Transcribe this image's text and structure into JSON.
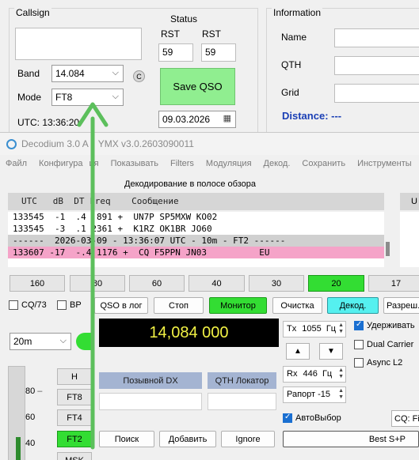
{
  "logger": {
    "callsign_title": "Callsign",
    "callsign_value": "",
    "band_label": "Band",
    "band_value": "14.084",
    "mode_label": "Mode",
    "mode_value": "FT8",
    "c_button": "C",
    "utc_label": "UTC: 13:36:20",
    "status_title": "Status",
    "rst_label_1": "RST",
    "rst_label_2": "RST",
    "rst_sent": "59",
    "rst_rcvd": "59",
    "save_button": "Save QSO",
    "date_value": "09.03.2026",
    "information_title": "Information",
    "name_label": "Name",
    "qth_label": "QTH",
    "grid_label": "Grid",
    "distance": "Distance: ---"
  },
  "window": {
    "title": "Decodium 3.0 AI... v3.0.2603090011",
    "title_visible_1": "Decodium 3.0 A",
    "title_visible_2": "YMX v3.0.2603090011",
    "menu": [
      "Файл",
      "Конфигурация",
      "Показывать",
      "Filters",
      "Модуляция",
      "Декод.",
      "Сохранить",
      "Инструменты"
    ],
    "menu_visible": [
      "Файл",
      "Конфигура",
      "ия",
      "Показывать",
      "Filters",
      "Модуляция",
      "Декод.",
      "Сохранить",
      "Инструменты"
    ]
  },
  "decode": {
    "title": "Декодирование в полосе обзора",
    "header": "UTC   dB  DT Freq    Сообщение",
    "right_header": "U",
    "lines": [
      {
        "text": "133545  -1  .4  891 +  UN7P SP5MXW KO02",
        "style": "normal"
      },
      {
        "text": "133545  -3  .1 2361 +  K1RZ OK1BR JO60",
        "style": "normal"
      },
      {
        "text": "------  2026-03-09 - 13:36:07 UTC - 10m - FT2 ------",
        "style": "sep"
      },
      {
        "text": "133607 -17  -.4 1176 +  CQ F5PPN JN03          EU",
        "style": "cq"
      }
    ]
  },
  "bands": [
    {
      "label": "160",
      "active": false
    },
    {
      "label": "80",
      "active": false
    },
    {
      "label": "60",
      "active": false
    },
    {
      "label": "40",
      "active": false
    },
    {
      "label": "30",
      "active": false
    },
    {
      "label": "20",
      "active": true
    },
    {
      "label": "17",
      "active": false
    }
  ],
  "controls": {
    "cq73": "CQ/73",
    "bp": "BP",
    "qso_log": "QSO в лог",
    "stop": "Стоп",
    "monitor": "Монитор",
    "clear": "Очистка",
    "decode": "Декод.",
    "enable": "Разреш...",
    "band_select": "20m",
    "frequency": "14,084 000",
    "tx_label": "Tx",
    "tx_value": "1055",
    "tx_unit": "Гц",
    "rx_label": "Rx",
    "rx_value": "446",
    "rx_unit": "Гц",
    "report": "Рапорт -15",
    "up_arrow": "▲",
    "down_arrow": "▼",
    "hold": "Удерживать",
    "dual_carrier": "Dual Carrier",
    "async_l2": "Async L2",
    "auto_select": "АвтоВыбор",
    "cq_fi": "CQ: Fi",
    "callsign_dx": "Позывной DX",
    "qth_locator": "QTH Локатор",
    "search": "Поиск",
    "add": "Добавить",
    "ignore": "Ignore",
    "best_sp": "Best S+P",
    "modes": [
      {
        "label": "H",
        "active": false
      },
      {
        "label": "FT8",
        "active": false
      },
      {
        "label": "FT4",
        "active": false
      },
      {
        "label": "FT2",
        "active": true
      },
      {
        "label": "MSK",
        "active": false
      }
    ],
    "meter_scale": [
      "80",
      "60",
      "40"
    ],
    "meter_level": 0.25
  },
  "colors": {
    "active_green": "#33dd33",
    "save_green": "#90ee90",
    "cq_pink": "#f5a3c8",
    "freq_yellow": "#f2f245",
    "arrow_green": "#5cbf5c",
    "distance_blue": "#1a3fb5"
  }
}
